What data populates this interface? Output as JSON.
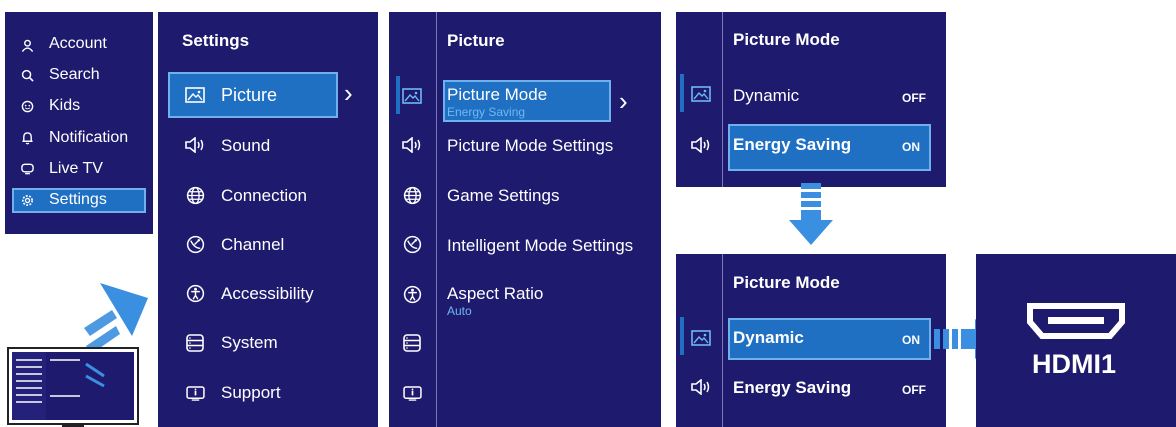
{
  "main_menu": {
    "items": [
      {
        "label": "Account",
        "icon": "account-icon"
      },
      {
        "label": "Search",
        "icon": "search-icon"
      },
      {
        "label": "Kids",
        "icon": "kids-icon"
      },
      {
        "label": "Notification",
        "icon": "bell-icon"
      },
      {
        "label": "Live TV",
        "icon": "tv-icon"
      },
      {
        "label": "Settings",
        "icon": "gear-icon",
        "selected": true
      }
    ]
  },
  "settings": {
    "title": "Settings",
    "items": [
      {
        "label": "Picture",
        "icon": "picture-icon",
        "selected": true
      },
      {
        "label": "Sound",
        "icon": "speaker-icon"
      },
      {
        "label": "Connection",
        "icon": "globe-icon"
      },
      {
        "label": "Channel",
        "icon": "satellite-icon"
      },
      {
        "label": "Accessibility",
        "icon": "accessibility-icon"
      },
      {
        "label": "System",
        "icon": "system-icon"
      },
      {
        "label": "Support",
        "icon": "info-icon"
      }
    ]
  },
  "picture": {
    "title": "Picture",
    "items": [
      {
        "label": "Picture Mode",
        "sub": "Energy Saving",
        "selected": true
      },
      {
        "label": "Picture Mode Settings"
      },
      {
        "label": "Game Settings"
      },
      {
        "label": "Intelligent Mode Settings"
      },
      {
        "label": "Aspect Ratio",
        "sub": "Auto"
      }
    ]
  },
  "mode_top": {
    "title": "Picture Mode",
    "items": [
      {
        "label": "Dynamic",
        "status": "OFF"
      },
      {
        "label": "Energy Saving",
        "status": "ON",
        "selected": true
      }
    ]
  },
  "mode_bottom": {
    "title": "Picture Mode",
    "items": [
      {
        "label": "Dynamic",
        "status": "ON",
        "selected": true
      },
      {
        "label": "Energy Saving",
        "status": "OFF"
      }
    ]
  },
  "hdmi": {
    "label": "HDMI1",
    "icon": "hdmi-port-icon"
  },
  "colors": {
    "panel": "#1e1b6e",
    "highlight": "#1f6fc2",
    "arrow": "#3a8fe0",
    "sub_text": "#6fb8f2"
  }
}
